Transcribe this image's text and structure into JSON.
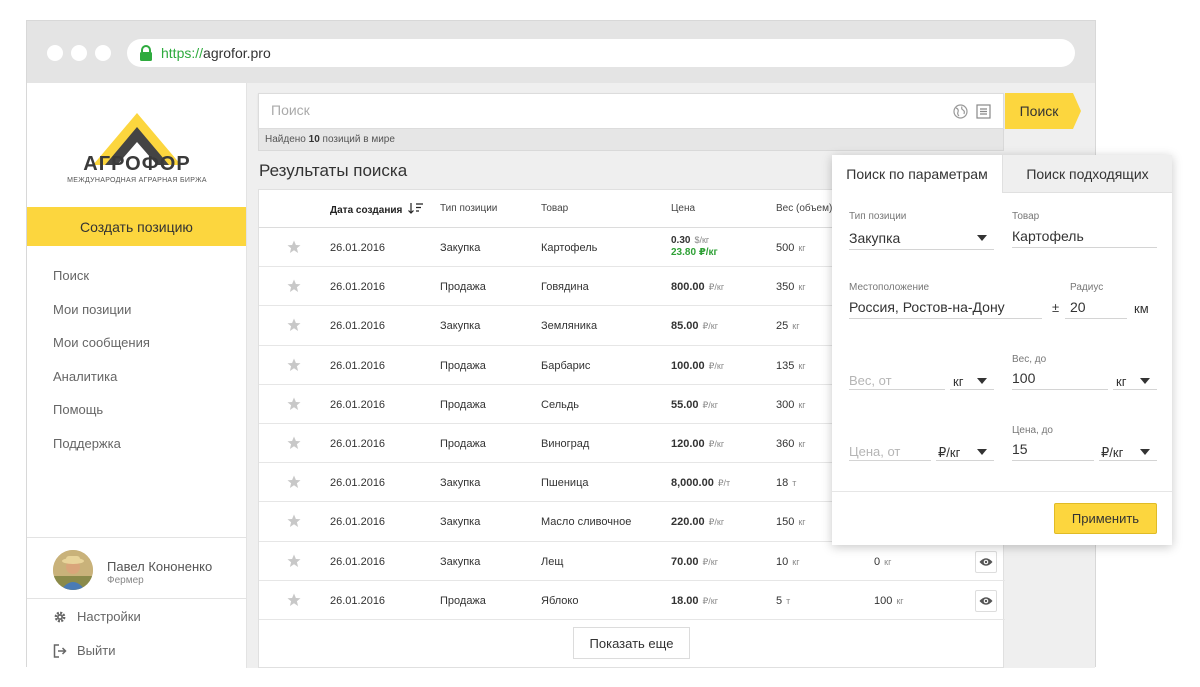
{
  "browser": {
    "url_scheme": "https://",
    "url_host": "agrofor.pro"
  },
  "brand": {
    "name": "АГРОФОР",
    "tagline": "МЕЖДУНАРОДНАЯ АГРАРНАЯ БИРЖА",
    "accent": "#fcd63e"
  },
  "sidebar": {
    "create_label": "Создать позицию",
    "items": [
      {
        "label": "Поиск"
      },
      {
        "label": "Мои позиции"
      },
      {
        "label": "Мои сообщения"
      },
      {
        "label": "Аналитика"
      },
      {
        "label": "Помощь"
      },
      {
        "label": "Поддержка"
      }
    ],
    "user": {
      "name": "Павел Кононенко",
      "role": "Фермер"
    },
    "settings_label": "Настройки",
    "logout_label": "Выйти"
  },
  "search": {
    "placeholder": "Поиск",
    "button_label": "Поиск",
    "found_prefix": "Найдено",
    "found_count": "10",
    "found_suffix": "позиций в мире"
  },
  "results": {
    "title": "Результаты поиска",
    "columns": {
      "date": "Дата создания",
      "type": "Тип позиции",
      "product": "Товар",
      "price": "Цена",
      "weight": "Вес (объем)"
    },
    "rows": [
      {
        "date": "26.01.2016",
        "type": "Закупка",
        "product": "Картофель",
        "price": "0.30",
        "price_unit": "$/кг",
        "price_alt": "23.80",
        "price_alt_unit": "₽/кг",
        "weight": "500",
        "weight_unit": "кг"
      },
      {
        "date": "26.01.2016",
        "type": "Продажа",
        "product": "Говядина",
        "price": "800.00",
        "price_unit": "₽/кг",
        "weight": "350",
        "weight_unit": "кг"
      },
      {
        "date": "26.01.2016",
        "type": "Закупка",
        "product": "Земляника",
        "price": "85.00",
        "price_unit": "₽/кг",
        "weight": "25",
        "weight_unit": "кг"
      },
      {
        "date": "26.01.2016",
        "type": "Продажа",
        "product": "Барбарис",
        "price": "100.00",
        "price_unit": "₽/кг",
        "weight": "135",
        "weight_unit": "кг"
      },
      {
        "date": "26.01.2016",
        "type": "Продажа",
        "product": "Сельдь",
        "price": "55.00",
        "price_unit": "₽/кг",
        "weight": "300",
        "weight_unit": "кг"
      },
      {
        "date": "26.01.2016",
        "type": "Продажа",
        "product": "Виноград",
        "price": "120.00",
        "price_unit": "₽/кг",
        "weight": "360",
        "weight_unit": "кг"
      },
      {
        "date": "26.01.2016",
        "type": "Закупка",
        "product": "Пшеница",
        "price": "8,000.00",
        "price_unit": "₽/т",
        "weight": "18",
        "weight_unit": "т"
      },
      {
        "date": "26.01.2016",
        "type": "Закупка",
        "product": "Масло сливочное",
        "price": "220.00",
        "price_unit": "₽/кг",
        "weight": "150",
        "weight_unit": "кг"
      },
      {
        "date": "26.01.2016",
        "type": "Закупка",
        "product": "Лещ",
        "price": "70.00",
        "price_unit": "₽/кг",
        "weight": "10",
        "weight_unit": "кг",
        "weight2": "0",
        "weight2_unit": "кг"
      },
      {
        "date": "26.01.2016",
        "type": "Продажа",
        "product": "Яблоко",
        "price": "18.00",
        "price_unit": "₽/кг",
        "weight": "5",
        "weight_unit": "т",
        "weight2": "100",
        "weight2_unit": "кг"
      }
    ],
    "more_label": "Показать еще"
  },
  "filter": {
    "tab_params": "Поиск по параметрам",
    "tab_similar": "Поиск подходящих",
    "position_type_label": "Тип позиции",
    "position_type_value": "Закупка",
    "product_label": "Товар",
    "product_value": "Картофель",
    "location_label": "Местоположение",
    "location_value": "Россия, Ростов-на-Дону",
    "plus_minus": "±",
    "radius_label": "Радиус",
    "radius_value": "20",
    "radius_unit": "км",
    "weight_from_placeholder": "Вес, от",
    "weight_from_unit": "кг",
    "weight_to_label": "Вес, до",
    "weight_to_value": "100",
    "weight_to_unit": "кг",
    "price_from_placeholder": "Цена, от",
    "price_from_unit": "₽/кг",
    "price_to_label": "Цена, до",
    "price_to_value": "15",
    "price_to_unit": "₽/кг",
    "apply_label": "Применить"
  }
}
